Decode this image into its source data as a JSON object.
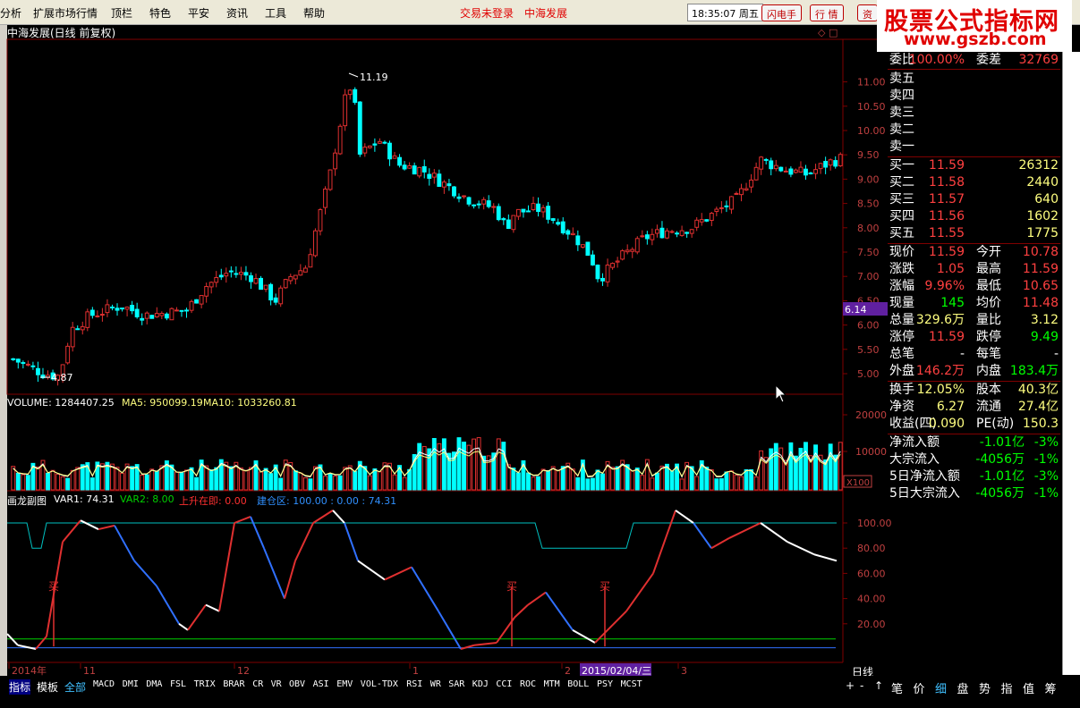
{
  "menubar": {
    "items": [
      "分析",
      "扩展市场行情",
      "顶栏",
      "特色",
      "平安",
      "资讯",
      "工具",
      "帮助"
    ],
    "trade_status": "交易未登录",
    "stock_name_top": "中海发展",
    "clock": "18:35:07 周五",
    "btn_flash": "闪电手",
    "btn_quote": "行 情",
    "btn_asset": "资"
  },
  "watermark": {
    "title": "股票公式指标网",
    "url": "www.gszb.com"
  },
  "chart": {
    "title": "中海发展(日线 前复权)",
    "high_label": "11.19",
    "low_label": "4.87",
    "price_ticks": [
      "11.00",
      "10.50",
      "10.00",
      "9.50",
      "9.00",
      "8.50",
      "8.00",
      "7.50",
      "7.00",
      "6.50",
      "6.00",
      "5.50",
      "5.00"
    ],
    "price_tag": "6.14",
    "volume_header": {
      "label": "VOLUME: 1284407.25",
      "ma5": "MA5: 950099.19",
      "ma10": "MA10: 1033260.81"
    },
    "volume_ticks": [
      "20000",
      "10000"
    ],
    "volume_unit": "X100",
    "indicator_header": {
      "name": "画龙副图",
      "var1": "VAR1: 74.31",
      "var2": "VAR2: 8.00",
      "up": "上升在即: 0.00",
      "build": "建仓区: 100.00 : 0.00 : 74.31"
    },
    "indicator_ticks": [
      "100.00",
      "80.00",
      "60.00",
      "40.00",
      "20.00"
    ],
    "buy_label": "买",
    "date_axis": [
      "2014年",
      "11",
      "12",
      "1",
      "2",
      "2015/02/04/三",
      "3"
    ],
    "period": "日线"
  },
  "colors": {
    "up": "#e03030",
    "down": "#00ffff",
    "ma5": "#ffffff",
    "ma10": "#ffff80",
    "grid": "#800000",
    "teal_line": "#00c0c0",
    "green_line": "#00d000",
    "blue_line": "#3070ff"
  },
  "quote": {
    "commission_ratio": {
      "k1": "委比",
      "v1": "100.00%",
      "k2": "委差",
      "v2": "32769"
    },
    "sell": [
      {
        "label": "卖五"
      },
      {
        "label": "卖四"
      },
      {
        "label": "卖三"
      },
      {
        "label": "卖二"
      },
      {
        "label": "卖一"
      }
    ],
    "buy": [
      {
        "label": "买一",
        "price": "11.59",
        "vol": "26312"
      },
      {
        "label": "买二",
        "price": "11.58",
        "vol": "2440"
      },
      {
        "label": "买三",
        "price": "11.57",
        "vol": "640"
      },
      {
        "label": "买四",
        "price": "11.56",
        "vol": "1602"
      },
      {
        "label": "买五",
        "price": "11.55",
        "vol": "1775"
      }
    ],
    "stats": [
      {
        "k1": "现价",
        "v1": "11.59",
        "k2": "今开",
        "v2": "10.78"
      },
      {
        "k1": "涨跌",
        "v1": "1.05",
        "k2": "最高",
        "v2": "11.59"
      },
      {
        "k1": "涨幅",
        "v1": "9.96%",
        "k2": "最低",
        "v2": "10.65"
      },
      {
        "k1": "现量",
        "v1": "145",
        "k2": "均价",
        "v2": "11.48"
      },
      {
        "k1": "总量",
        "v1": "329.6万",
        "k2": "量比",
        "v2": "3.12"
      },
      {
        "k1": "涨停",
        "v1": "11.59",
        "k2": "跌停",
        "v2": "9.49"
      },
      {
        "k1": "总笔",
        "v1": "-",
        "k2": "每笔",
        "v2": "-"
      },
      {
        "k1": "外盘",
        "v1": "146.2万",
        "k2": "内盘",
        "v2": "183.4万"
      }
    ],
    "finance": [
      {
        "k1": "换手",
        "v1": "12.05%",
        "k2": "股本",
        "v2": "40.3亿"
      },
      {
        "k1": "净资",
        "v1": "6.27",
        "k2": "流通",
        "v2": "27.4亿"
      },
      {
        "k1": "收益(四)",
        "v1": "0.090",
        "k2": "PE(动)",
        "v2": "150.3"
      }
    ],
    "flow": [
      {
        "k": "净流入额",
        "v": "-1.01亿",
        "p": "-3%"
      },
      {
        "k": "大宗流入",
        "v": "-4056万",
        "p": "-1%"
      },
      {
        "k": "5日净流入额",
        "v": "-1.01亿",
        "p": "-3%"
      },
      {
        "k": "5日大宗流入",
        "v": "-4056万",
        "p": "-1%"
      }
    ]
  },
  "bottom": {
    "tabs": [
      "指标",
      "模板",
      "全部"
    ],
    "indicators": [
      "MACD",
      "DMI",
      "DMA",
      "FSL",
      "TRIX",
      "BRAR",
      "CR",
      "VR",
      "OBV",
      "ASI",
      "EMV",
      "VOL-TDX",
      "RSI",
      "WR",
      "SAR",
      "KDJ",
      "CCI",
      "ROC",
      "MTM",
      "BOLL",
      "PSY",
      "MCST"
    ],
    "right_tabs": [
      "笔",
      "价",
      "细",
      "盘",
      "势",
      "指",
      "值",
      "筹"
    ],
    "ctrl": [
      "+",
      "-",
      "↑"
    ]
  }
}
